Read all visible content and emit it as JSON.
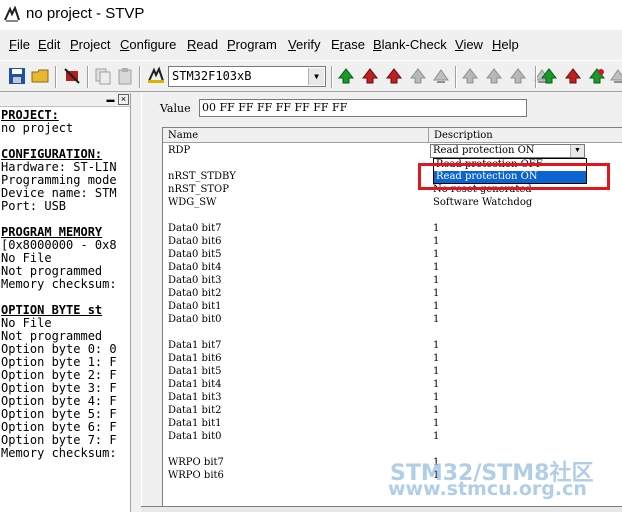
{
  "window": {
    "title": "no project - STVP"
  },
  "menu": [
    {
      "label": "File",
      "key": "F",
      "rest": "ile"
    },
    {
      "label": "Edit",
      "key": "E",
      "rest": "dit"
    },
    {
      "label": "Project",
      "key": "P",
      "rest": "roject"
    },
    {
      "label": "Configure",
      "key": "C",
      "rest": "onfigure"
    },
    {
      "label": "Read",
      "key": "R",
      "rest": "ead"
    },
    {
      "label": "Program",
      "key": "P",
      "rest": "rogram"
    },
    {
      "label": "Verify",
      "key": "V",
      "rest": "erify"
    },
    {
      "label": "Erase",
      "pre": "E",
      "key": "r",
      "rest": "ase"
    },
    {
      "label": "Blank-Check",
      "key": "B",
      "rest": "lank-Check"
    },
    {
      "label": "View",
      "key": "V",
      "rest": "iew"
    },
    {
      "label": "Help",
      "key": "H",
      "rest": "elp"
    }
  ],
  "toolbar": {
    "device": "STM32F103xB",
    "icons": [
      "save-icon",
      "open-icon",
      "chip-config-icon",
      "copy-icon",
      "paste-icon",
      "device-icon",
      "read-all-icon",
      "read-current-icon",
      "verify-icon",
      "program-icon",
      "erase-icon",
      "read-all-icon-2",
      "read-current-icon-2",
      "verify-icon-2",
      "program-icon-2",
      "erase-icon-2",
      "program-all-icon",
      "program-current-icon",
      "verify-all-icon",
      "erase-all-icon"
    ]
  },
  "left_panel": {
    "lines": [
      {
        "text": "PROJECT:",
        "head": true
      },
      {
        "text": "no project"
      },
      {
        "text": ""
      },
      {
        "text": "CONFIGURATION:",
        "head": true
      },
      {
        "text": "Hardware: ST-LIN"
      },
      {
        "text": "Programming mode"
      },
      {
        "text": "Device name: STM"
      },
      {
        "text": "Port: USB"
      },
      {
        "text": ""
      },
      {
        "text": "PROGRAM MEMORY",
        "head": true
      },
      {
        "text": "[0x8000000 - 0x8"
      },
      {
        "text": "No File"
      },
      {
        "text": "Not programmed"
      },
      {
        "text": "Memory checksum:"
      },
      {
        "text": ""
      },
      {
        "text": "OPTION BYTE st",
        "head": true
      },
      {
        "text": "No File"
      },
      {
        "text": "Not programmed"
      },
      {
        "text": "Option byte 0: 0"
      },
      {
        "text": "Option byte 1: F"
      },
      {
        "text": "Option byte 2: F"
      },
      {
        "text": "Option byte 3: F"
      },
      {
        "text": "Option byte 4: F"
      },
      {
        "text": "Option byte 5: F"
      },
      {
        "text": "Option byte 6: F"
      },
      {
        "text": "Option byte 7: F"
      },
      {
        "text": "Memory checksum:"
      }
    ]
  },
  "value_field": {
    "label": "Value",
    "value": "00 FF FF FF FF FF FF FF"
  },
  "grid": {
    "headers": [
      "Name",
      "Description"
    ],
    "rdp": {
      "name": "RDP",
      "value": "Read protection ON",
      "options": [
        "Read protection OFF",
        "Read protection ON"
      ],
      "selected": 1
    },
    "rows": [
      {
        "name": "nRST_STDBY",
        "desc": ""
      },
      {
        "name": "nRST_STOP",
        "desc": "No reset generated"
      },
      {
        "name": "WDG_SW",
        "desc": "Software Watchdog"
      },
      {
        "name": "",
        "desc": ""
      },
      {
        "name": "Data0 bit7",
        "desc": "1"
      },
      {
        "name": "Data0 bit6",
        "desc": "1"
      },
      {
        "name": "Data0 bit5",
        "desc": "1"
      },
      {
        "name": "Data0 bit4",
        "desc": "1"
      },
      {
        "name": "Data0 bit3",
        "desc": "1"
      },
      {
        "name": "Data0 bit2",
        "desc": "1"
      },
      {
        "name": "Data0 bit1",
        "desc": "1"
      },
      {
        "name": "Data0 bit0",
        "desc": "1"
      },
      {
        "name": "",
        "desc": ""
      },
      {
        "name": "Data1 bit7",
        "desc": "1"
      },
      {
        "name": "Data1 bit6",
        "desc": "1"
      },
      {
        "name": "Data1 bit5",
        "desc": "1"
      },
      {
        "name": "Data1 bit4",
        "desc": "1"
      },
      {
        "name": "Data1 bit3",
        "desc": "1"
      },
      {
        "name": "Data1 bit2",
        "desc": "1"
      },
      {
        "name": "Data1 bit1",
        "desc": "1"
      },
      {
        "name": "Data1 bit0",
        "desc": "1"
      },
      {
        "name": "",
        "desc": ""
      },
      {
        "name": "WRPO bit7",
        "desc": "1"
      },
      {
        "name": "WRPO bit6",
        "desc": "1"
      }
    ]
  },
  "watermark": {
    "line1": "STM32/STM8社区",
    "line2": "www.stmcu.org.cn"
  },
  "colors": {
    "selection": "#0a64d2",
    "highlight_box": "#e4151f"
  }
}
